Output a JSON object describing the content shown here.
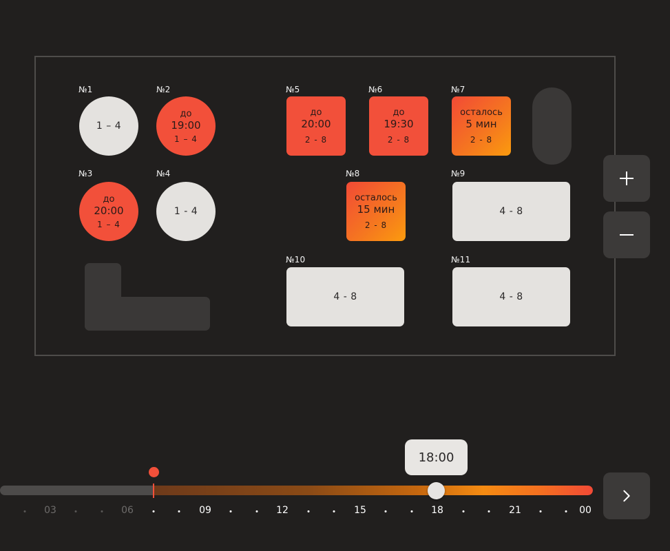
{
  "tables": {
    "t1": {
      "num": "№1",
      "cap": "1 – 4"
    },
    "t2": {
      "num": "№2",
      "top": "до",
      "mid": "19:00",
      "cap": "1 – 4"
    },
    "t3": {
      "num": "№3",
      "top": "до",
      "mid": "20:00",
      "cap": "1 – 4"
    },
    "t4": {
      "num": "№4",
      "cap": "1 - 4"
    },
    "t5": {
      "num": "№5",
      "top": "до",
      "mid": "20:00",
      "cap": "2 - 8"
    },
    "t6": {
      "num": "№6",
      "top": "до",
      "mid": "19:30",
      "cap": "2 - 8"
    },
    "t7": {
      "num": "№7",
      "top": "осталось",
      "mid": "5 мин",
      "cap": "2 - 8"
    },
    "t8": {
      "num": "№8",
      "top": "осталось",
      "mid": "15 мин",
      "cap": "2 - 8"
    },
    "t9": {
      "num": "№9",
      "cap": "4 - 8"
    },
    "t10": {
      "num": "№10",
      "cap": "4 - 8"
    },
    "t11": {
      "num": "№11",
      "cap": "4 - 8"
    }
  },
  "zoom": {
    "in_icon": "plus-icon",
    "out_icon": "minus-icon"
  },
  "timeline": {
    "selected_time": "18:00",
    "ticks": [
      "03",
      "06",
      "09",
      "12",
      "15",
      "18",
      "21",
      "00"
    ],
    "next_icon": "chevron-right-icon"
  },
  "colors": {
    "background": "#211f1e",
    "free": "#e4e2df",
    "busy": "#f2503a",
    "soon": "#f5781f"
  }
}
